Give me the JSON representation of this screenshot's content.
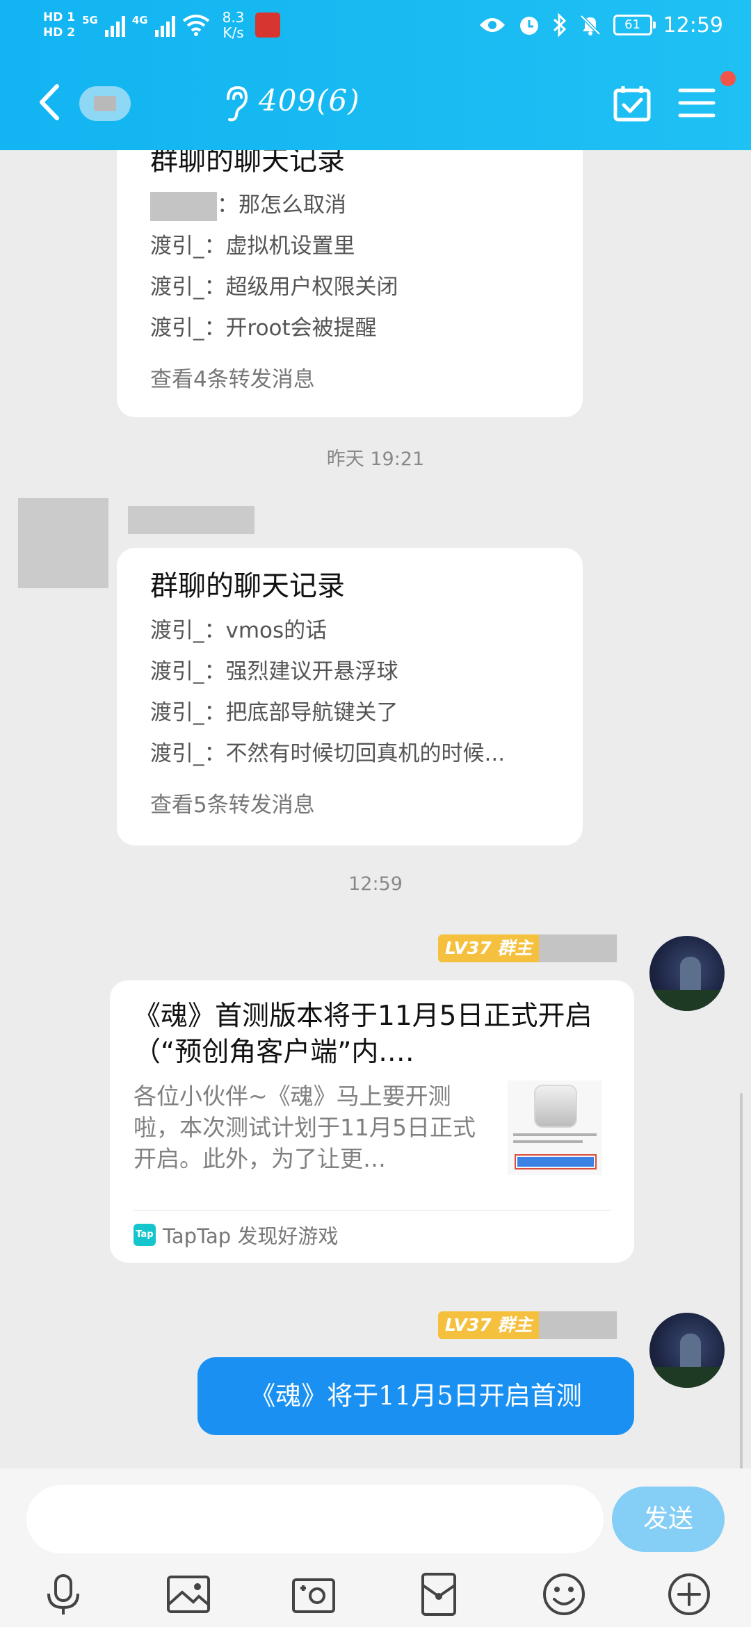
{
  "status_bar": {
    "sim1": "HD 1",
    "sim2": "HD 2",
    "net1": "5G",
    "net2": "4G",
    "speed_value": "8.3",
    "speed_unit": "K/s",
    "battery": "61",
    "time": "12:59"
  },
  "header": {
    "title": "409(6)",
    "brand_color": "#1cb8f2"
  },
  "chat": {
    "messages": [
      {
        "type": "forward",
        "title": "群聊的聊天记录",
        "lines": [
          {
            "sender": "",
            "text": "：那怎么取消"
          },
          {
            "sender": "渡引_",
            "text": "：虚拟机设置里"
          },
          {
            "sender": "渡引_",
            "text": "：超级用户权限关闭"
          },
          {
            "sender": "渡引_",
            "text": "：开root会被提醒"
          }
        ],
        "more": "查看4条转发消息"
      },
      {
        "type": "forward",
        "title": "群聊的聊天记录",
        "lines": [
          {
            "sender": "渡引_",
            "text": "：vmos的话"
          },
          {
            "sender": "渡引_",
            "text": "：强烈建议开悬浮球"
          },
          {
            "sender": "渡引_",
            "text": "：把底部导航键关了"
          },
          {
            "sender": "渡引_",
            "text": "：不然有时候切回真机的时候..."
          }
        ],
        "more": "查看5条转发消息"
      }
    ],
    "timestamps": [
      "昨天 19:21",
      "12:59"
    ],
    "my_badge": "LV37 群主",
    "share": {
      "title": "《魂》首测版本将于11月5日正式开启（“预创角客户端”内.…",
      "desc": "各位小伙伴~《魂》马上要开测啦，本次测试计划于11月5日正式开启。此外，为了让更…",
      "source": "TapTap 发现好游戏",
      "source_icon": "Tap"
    },
    "my_text": "《魂》将于11月5日开启首测"
  },
  "input": {
    "placeholder": "",
    "send_label": "发送"
  },
  "toolbar_icons": [
    "microphone-icon",
    "image-icon",
    "camera-icon",
    "red-packet-icon",
    "emoji-icon",
    "plus-icon"
  ]
}
